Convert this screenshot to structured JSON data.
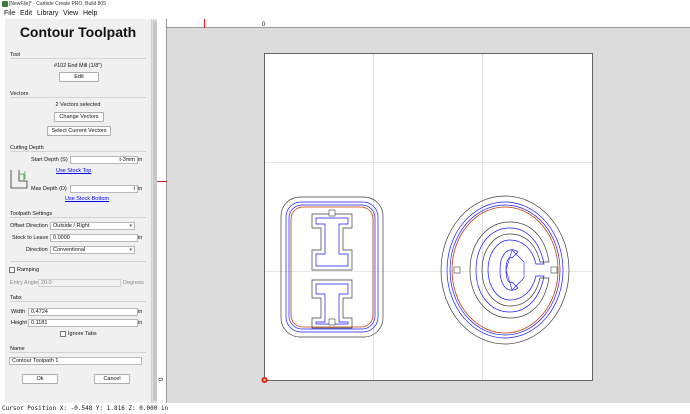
{
  "window": {
    "title": "[NewFile]* - Carbide Create PRO, Build 805"
  },
  "menu": [
    "File",
    "Edit",
    "Library",
    "View",
    "Help"
  ],
  "panel": {
    "title": "Contour Toolpath",
    "tool": {
      "section": "Tool",
      "name": "#102 End Mill (1/8\")",
      "edit_button": "Edit"
    },
    "vectors": {
      "section": "Vectors",
      "count_text": "2 Vectors selected",
      "change_button": "Change Vectors",
      "select_button": "Select Current Vectors"
    },
    "cutting_depth": {
      "section": "Cutting Depth",
      "start_label": "Start Depth (S)",
      "start_value": "t-3mm",
      "start_unit": "in",
      "use_stock_top": "Use Stock Top",
      "max_label": "Max Depth (D)",
      "max_value": "t",
      "max_unit": "in",
      "use_stock_bottom": "Use Stock Bottom"
    },
    "toolpath_settings": {
      "section": "Toolpath Settings",
      "offset_label": "Offset Direction",
      "offset_value": "Outside / Right",
      "stock_label": "Stock to Leave",
      "stock_value": "0.0000",
      "stock_unit": "in",
      "direction_label": "Direction",
      "direction_value": "Conventional"
    },
    "ramping": {
      "label": "Ramping",
      "checked": false,
      "entry_label": "Entry Angle",
      "entry_value": "20.0",
      "entry_unit": "Degrees"
    },
    "tabs": {
      "section": "Tabs",
      "width_label": "Width",
      "width_value": "0.4724",
      "width_unit": "in",
      "height_label": "Height",
      "height_value": "0.1181",
      "height_unit": "in",
      "ignore_label": "Ignore Tabs",
      "ignore_checked": false
    },
    "name": {
      "section": "Name",
      "value": "Contour Toolpath 1"
    },
    "ok_button": "Ok",
    "cancel_button": "Cancel"
  },
  "canvas": {
    "ruler_top_label": "0",
    "ruler_left_label": "0",
    "stock_color": "#ffffff",
    "outline_color": "#3c3c3c",
    "toolpath_color": "#1a1aff",
    "selected_color": "#c04000",
    "accent_red": "#dd2020"
  },
  "status": {
    "cursor_text": "Cursor Position X: -0.548 Y: 1.816 Z: 0.000 in"
  }
}
